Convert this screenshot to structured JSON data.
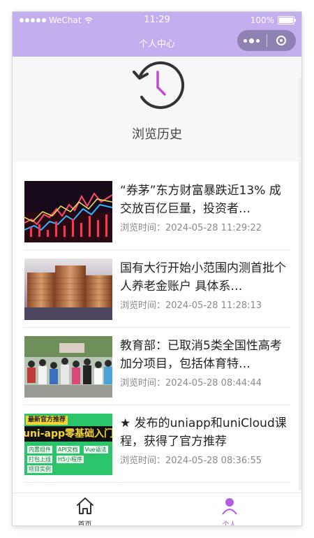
{
  "status_bar": {
    "carrier": "WeChat",
    "time": "11:29",
    "battery": "100%"
  },
  "nav": {
    "title": "个人中心"
  },
  "history": {
    "label": "浏览历史",
    "icon": "history-clock-icon"
  },
  "articles": [
    {
      "title": "“券茅”东方财富暴跌近13% 成交放百亿巨量，投资者…",
      "time": "浏览时间：2024-05-28 11:29:22",
      "thumb": "stock-chart-image"
    },
    {
      "title": "国有大行开始小范围内测首批个人养老金账户 具体系…",
      "time": "浏览时间：2024-05-28 11:28:13",
      "thumb": "coin-stacks-image"
    },
    {
      "title": "教育部：已取消5类全国性高考加分项目，包括体育特…",
      "time": "浏览时间：2024-05-28 08:44:44",
      "thumb": "students-crowd-image"
    },
    {
      "title": "★ 发布的uniapp和uniCloud课程，获得了官方推荐",
      "time": "浏览时间：2024-05-28 08:36:55",
      "thumb": "uniapp-banner-image",
      "banner_badge": "最新官方推荐",
      "banner_title": "uni-app零基础入门",
      "banner_tags": [
        "内置组件",
        "API文档",
        "Vue语法",
        "打包上线",
        "H5小程序",
        "项目实例"
      ]
    }
  ],
  "tabbar": {
    "home": "首页",
    "me": "个人"
  },
  "colors": {
    "accent": "#c3aef0",
    "active_tab": "#b25ce8",
    "clock_hand": "#c04bd8"
  }
}
